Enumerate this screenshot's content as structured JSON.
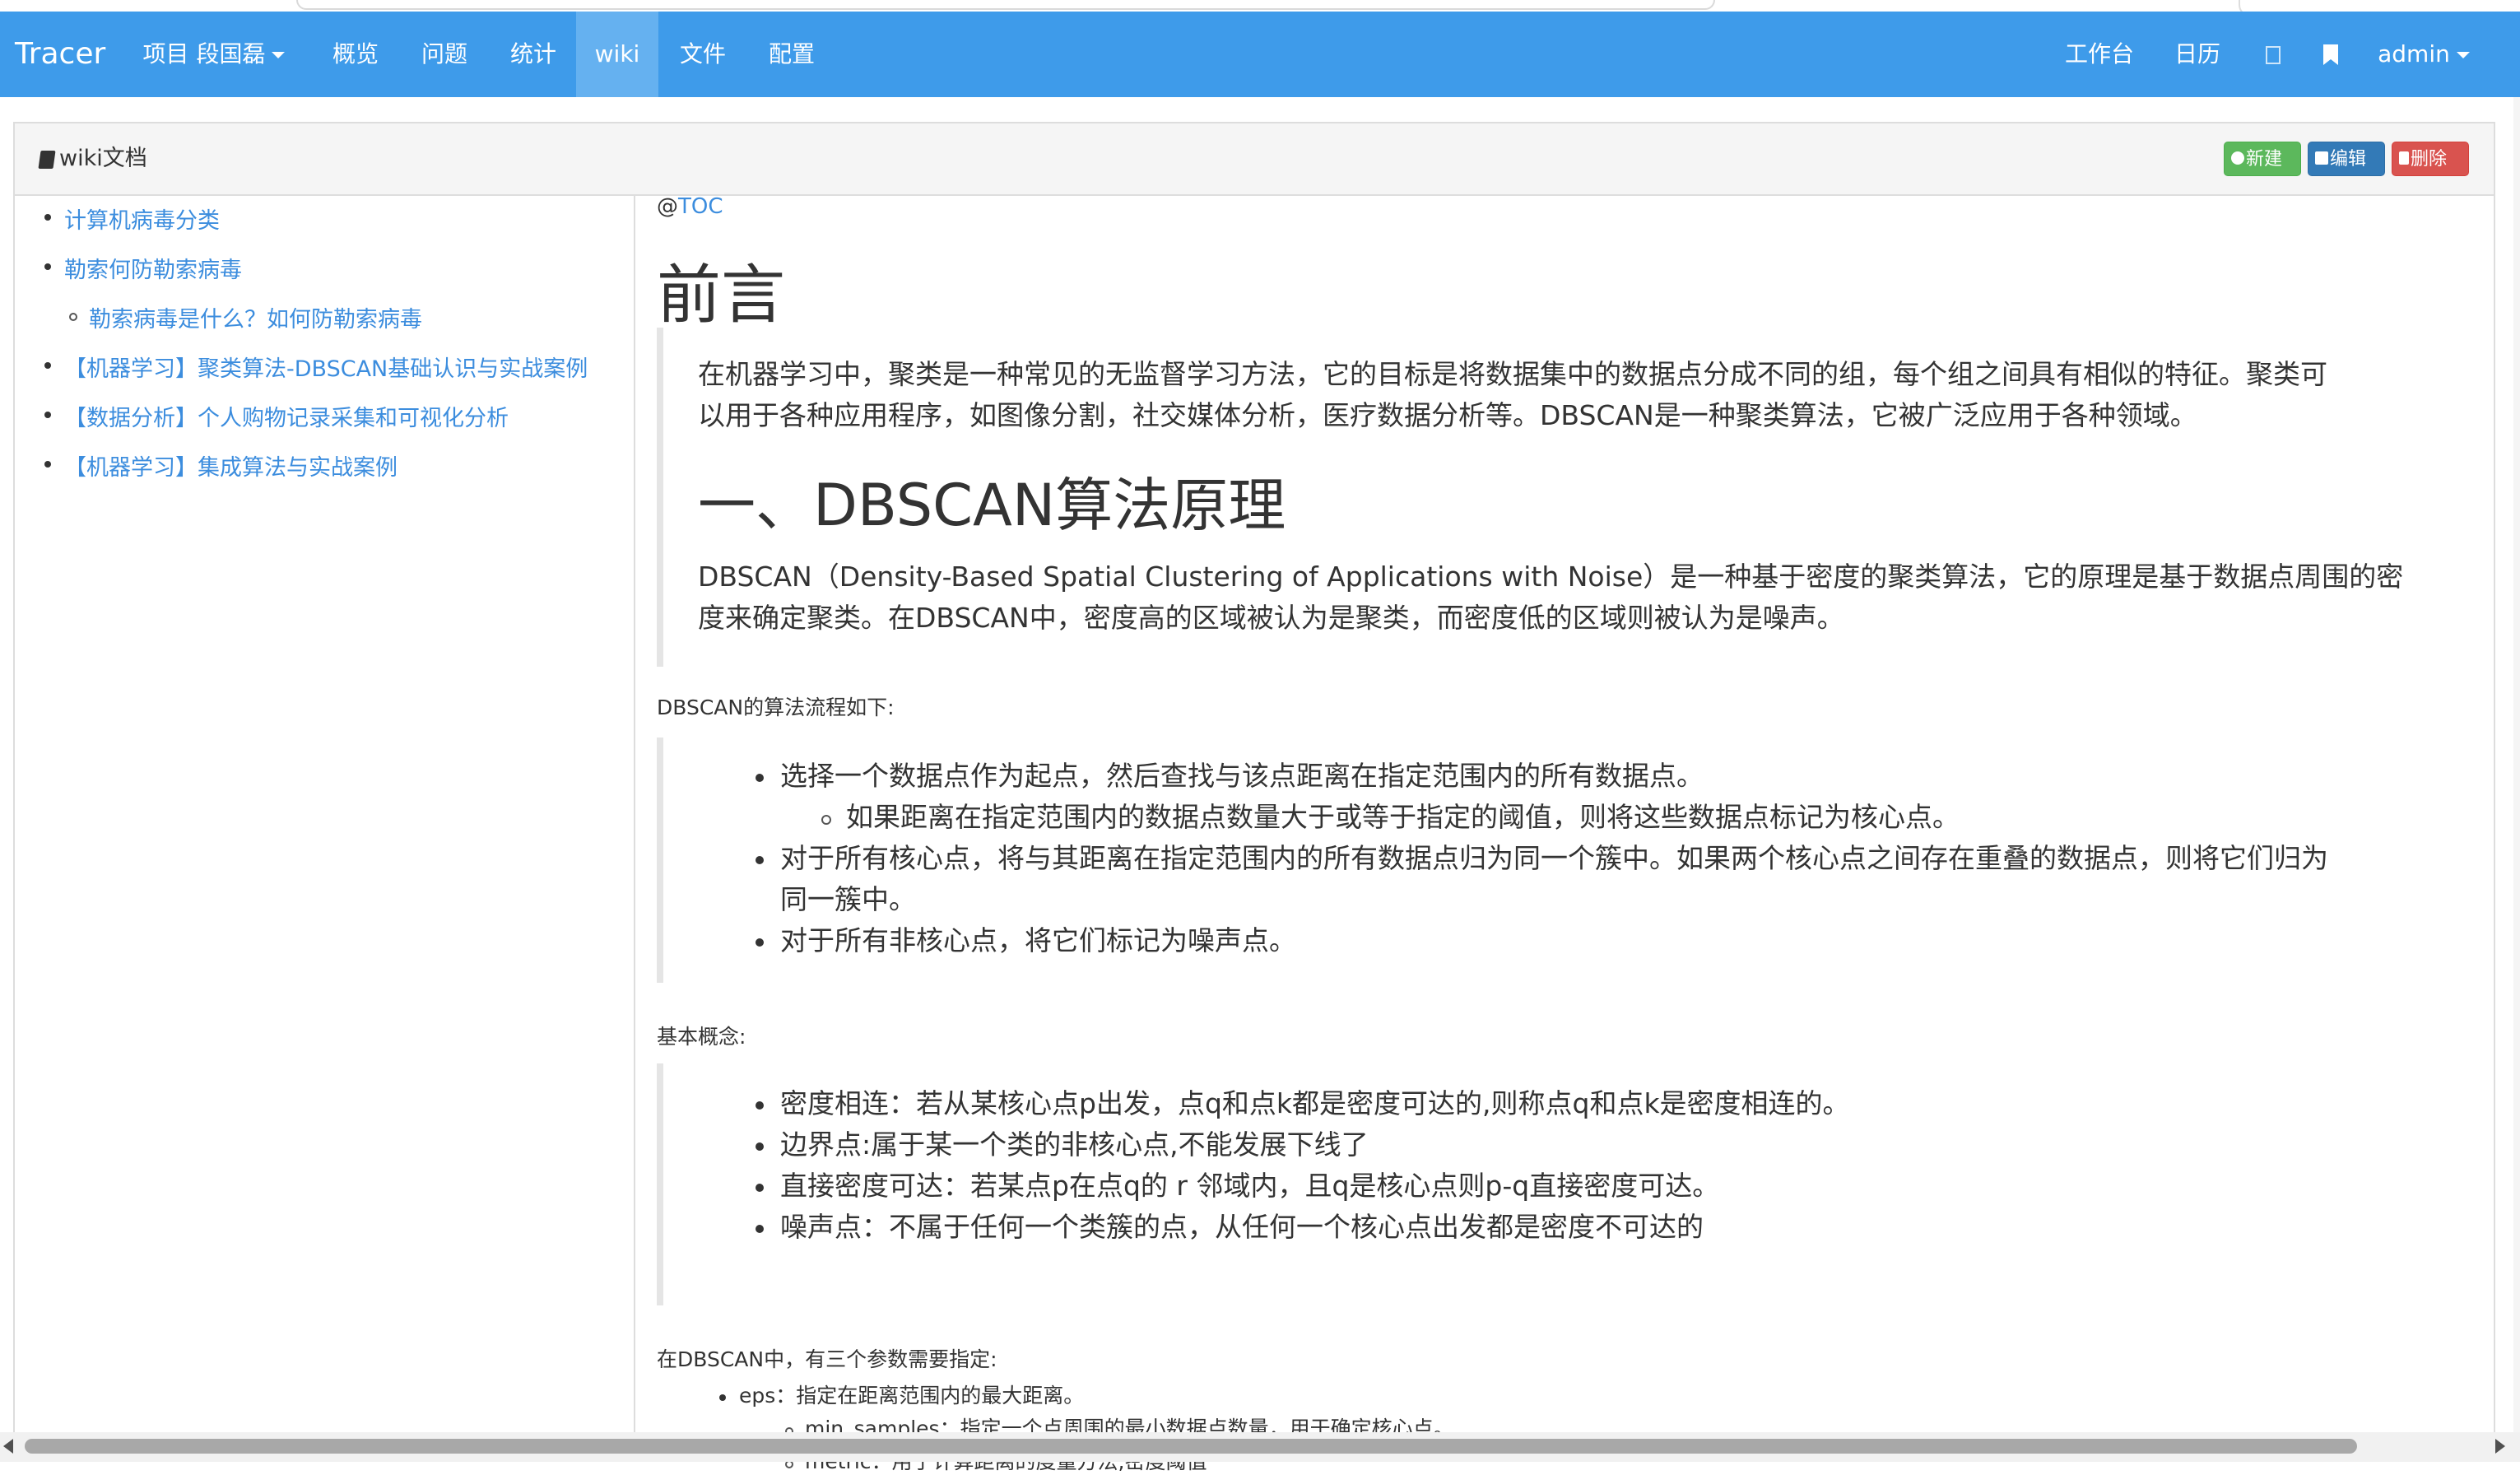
{
  "navbar": {
    "brand": "Tracer",
    "items": [
      {
        "label": "项目 段国磊"
      },
      {
        "label": "概览"
      },
      {
        "label": "问题"
      },
      {
        "label": "统计"
      },
      {
        "label": "wiki"
      },
      {
        "label": "文件"
      },
      {
        "label": "配置"
      }
    ],
    "right": {
      "workbench": "工作台",
      "calendar": "日历",
      "user": "admin"
    },
    "color": "#3e9bea",
    "active_item": "wiki"
  },
  "panel": {
    "title": "wiki文档",
    "buttons": {
      "new": "新建",
      "edit": "编辑",
      "delete": "删除"
    }
  },
  "toc": {
    "items": [
      {
        "label": "计算机病毒分类"
      },
      {
        "label": "勒索何防勒索病毒"
      },
      {
        "label": "勒索病毒是什么？如何防勒索病毒"
      },
      {
        "label": "【机器学习】聚类算法-DBSCAN基础认识与实战案例"
      },
      {
        "label": "【数据分析】个人购物记录采集和可视化分析"
      },
      {
        "label": "【机器学习】集成算法与实战案例"
      }
    ]
  },
  "article": {
    "toc_prefix": "@",
    "toc_link": "TOC",
    "h1": "前言",
    "intro_line1": "在机器学习中，聚类是一种常见的无监督学习方法，它的目标是将数据集中的数据点分成不同的组，每个组之间具有相似的特征。聚类可",
    "intro_line2": "以用于各种应用程序，如图像分割，社交媒体分析，医疗数据分析等。DBSCAN是一种聚类算法，它被广泛应用于各种领域。",
    "h2": "一、DBSCAN算法原理",
    "principle_line1": "DBSCAN（Density-Based Spatial Clustering of Applications with Noise）是一种基于密度的聚类算法，它的原理是基于数据点周围的密",
    "principle_line2": "度来确定聚类。在DBSCAN中，密度高的区域被认为是聚类，而密度低的区域则被认为是噪声。",
    "flow_title": "DBSCAN的算法流程如下:",
    "flow": {
      "step1": "选择一个数据点作为起点，然后查找与该点距离在指定范围内的所有数据点。",
      "step1_sub": "如果距离在指定范围内的数据点数量大于或等于指定的阈值，则将这些数据点标记为核心点。",
      "step2_line1": "对于所有核心点，将与其距离在指定范围内的所有数据点归为同一个簇中。如果两个核心点之间存在重叠的数据点，则将它们归为",
      "step2_line2": "同一簇中。",
      "step3": "对于所有非核心点，将它们标记为噪声点。"
    },
    "concepts_title": "基本概念:",
    "concepts": [
      "密度相连：若从某核心点p出发，点q和点k都是密度可达的,则称点q和点k是密度相连的。",
      "边界点:属于某一个类的非核心点,不能发展下线了",
      "直接密度可达：若某点p在点q的 r 邻域内，且q是核心点则p-q直接密度可达。",
      "噪声点：不属于任何一个类簇的点，从任何一个核心点出发都是密度不可达的"
    ],
    "params_title": "在DBSCAN中，有三个参数需要指定:",
    "params": {
      "eps_name": "eps",
      "eps_desc": "：指定在距离范围内的最大距离。",
      "min_samples_name": "min_samples",
      "min_samples_desc": "：指定一个点周围的最小数据点数量，用于确定核心点。",
      "metric_name": "metric",
      "metric_desc": "：用于计算距离的度量方法,密度阈值"
    }
  },
  "colors": {
    "link": "#3c8dde",
    "success": "#5cb85c",
    "primary": "#337ab7",
    "danger": "#d9534f"
  }
}
